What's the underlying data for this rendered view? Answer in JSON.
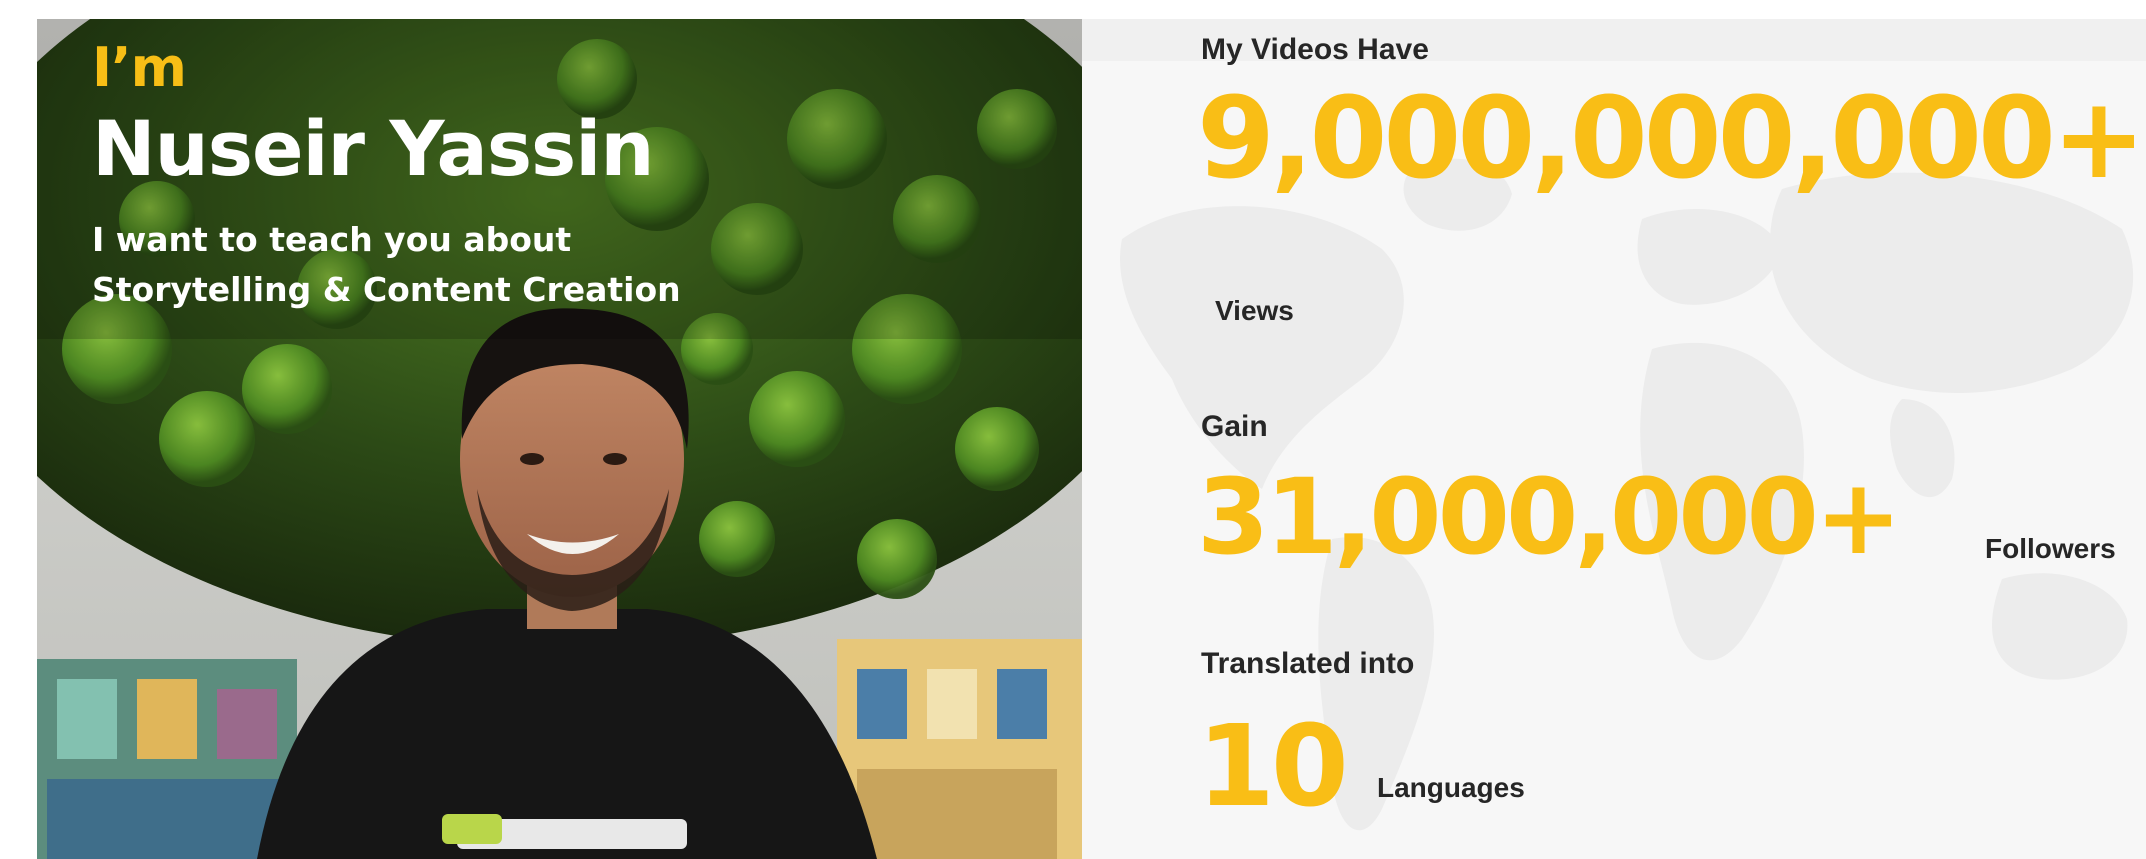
{
  "hero": {
    "intro": "I’m",
    "name": "Nuseir Yassin",
    "tagline_line1": "I want to teach you about",
    "tagline_line2": "Storytelling & Content Creation"
  },
  "stats": [
    {
      "label": "My Videos Have",
      "value": "9,000,000,000+",
      "unit": "Views"
    },
    {
      "label": "Gain",
      "value": "31,000,000+",
      "unit": "Followers"
    },
    {
      "label": "Translated into",
      "value": "10",
      "unit": "Languages"
    }
  ],
  "colors": {
    "accent": "#f9be16",
    "text_dark": "#262626",
    "text_light": "#ffffff"
  }
}
